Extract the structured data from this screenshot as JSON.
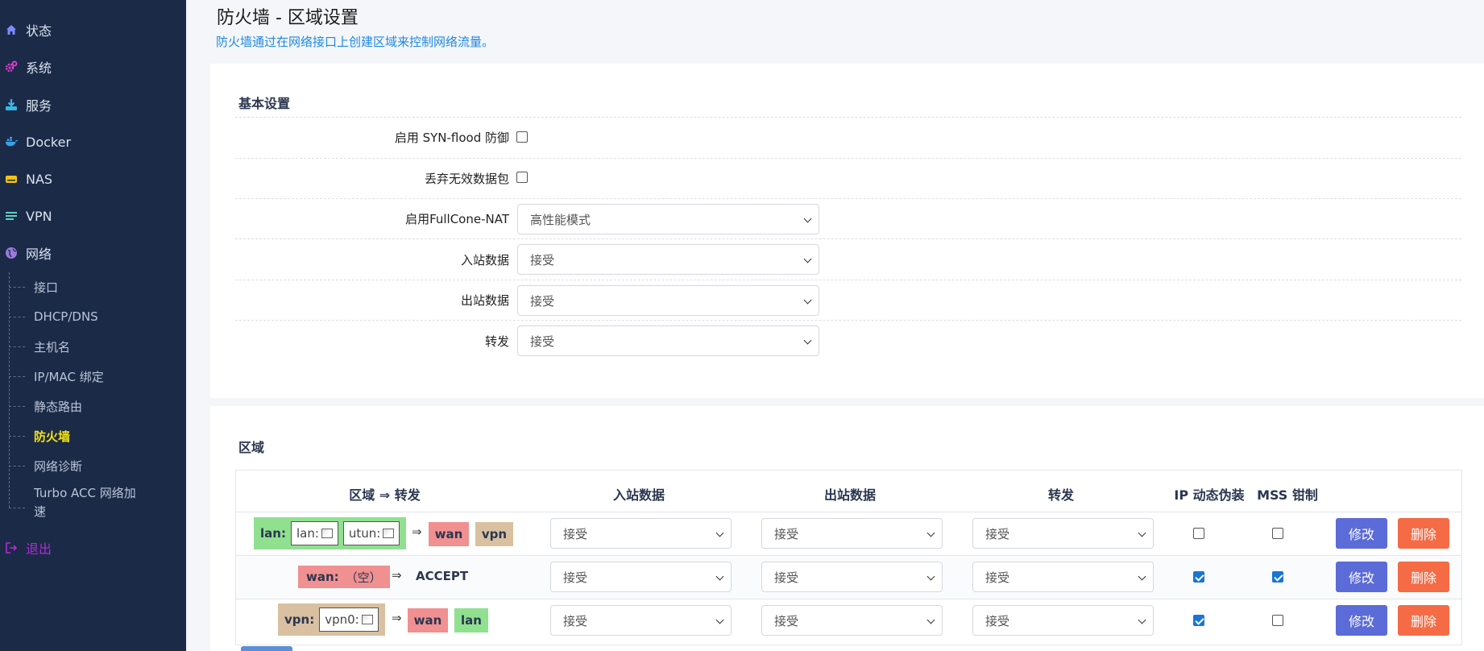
{
  "sidebar": {
    "items": [
      {
        "label": "状态",
        "icon": "home-icon",
        "color": "#7b8cff"
      },
      {
        "label": "系统",
        "icon": "gears-icon",
        "color": "#e83ed8"
      },
      {
        "label": "服务",
        "icon": "download-icon",
        "color": "#38b6e8"
      },
      {
        "label": "Docker",
        "icon": "docker-icon",
        "color": "#3aa0e8"
      },
      {
        "label": "NAS",
        "icon": "drive-icon",
        "color": "#f2c40f"
      },
      {
        "label": "VPN",
        "icon": "list-icon",
        "color": "#5fd0c0"
      },
      {
        "label": "网络",
        "icon": "globe-icon",
        "color": "#9a7bd8"
      }
    ],
    "subitems": [
      "接口",
      "DHCP/DNS",
      "主机名",
      "IP/MAC 绑定",
      "静态路由",
      "防火墙",
      "网络诊断",
      "Turbo ACC 网络加",
      "速"
    ],
    "active_subitem": "防火墙",
    "logout": "退出"
  },
  "header": {
    "title": "防火墙 - 区域设置",
    "description": "防火墙通过在网络接口上创建区域来控制网络流量。"
  },
  "basic": {
    "section_title": "基本设置",
    "syn_flood_label": "启用 SYN-flood 防御",
    "syn_flood_checked": false,
    "drop_invalid_label": "丢弃无效数据包",
    "drop_invalid_checked": false,
    "fullcone_label": "启用FullCone-NAT",
    "fullcone_value": "高性能模式",
    "input_label": "入站数据",
    "input_value": "接受",
    "output_label": "出站数据",
    "output_value": "接受",
    "forward_label": "转发",
    "forward_value": "接受"
  },
  "zones": {
    "section_title": "区域",
    "headers": {
      "zone": "区域 ⇒ 转发",
      "input": "入站数据",
      "output": "出站数据",
      "forward": "转发",
      "masq": "IP 动态伪装",
      "mss": "MSS 钳制"
    },
    "arrow": "⇒",
    "edit_label": "修改",
    "delete_label": "删除",
    "colors": {
      "lan": "#90e090",
      "wan": "#f09090",
      "vpn": "#d8c0a0"
    },
    "rows": [
      {
        "zone": "lan:",
        "networks": [
          "lan:",
          "utun:"
        ],
        "forwards": [
          "wan",
          "vpn"
        ],
        "input": "接受",
        "output": "接受",
        "forward": "接受",
        "masq": false,
        "mss": false
      },
      {
        "zone": "wan:",
        "empty_text": "（空）",
        "forward_text": "ACCEPT",
        "input": "接受",
        "output": "接受",
        "forward": "接受",
        "masq": true,
        "mss": true
      },
      {
        "zone": "vpn:",
        "networks": [
          "vpn0:"
        ],
        "forwards": [
          "wan",
          "lan"
        ],
        "input": "接受",
        "output": "接受",
        "forward": "接受",
        "masq": true,
        "mss": false
      }
    ]
  }
}
